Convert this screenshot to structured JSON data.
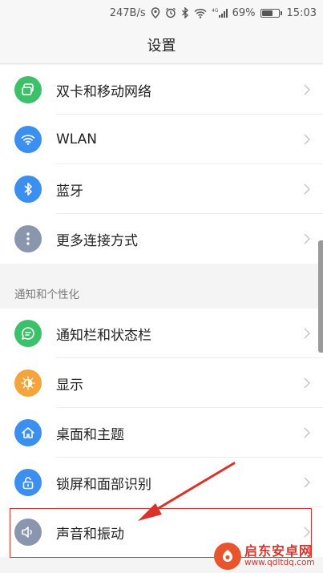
{
  "status_bar": {
    "net_speed": "247B/s",
    "signal": "4G",
    "battery": "69%",
    "battery_level": 0.69,
    "time": "15:03"
  },
  "header": {
    "title": "设置"
  },
  "connectivity": [
    {
      "label": "双卡和移动网络",
      "icon": "dual-sim-icon",
      "color": "#3cc06a"
    },
    {
      "label": "WLAN",
      "icon": "wifi-icon",
      "color": "#3b8ff0"
    },
    {
      "label": "蓝牙",
      "icon": "bluetooth-icon",
      "color": "#3b8ff0"
    },
    {
      "label": "更多连接方式",
      "icon": "more-dots-icon",
      "color": "#8a96ad"
    }
  ],
  "personalization": {
    "header": "通知和个性化",
    "items": [
      {
        "label": "通知栏和状态栏",
        "icon": "notification-icon",
        "color": "#3cc06a"
      },
      {
        "label": "显示",
        "icon": "display-icon",
        "color": "#f3a53c"
      },
      {
        "label": "桌面和主题",
        "icon": "home-icon",
        "color": "#3b8ff0"
      },
      {
        "label": "锁屏和面部识别",
        "icon": "lock-icon",
        "color": "#3b8ff0"
      },
      {
        "label": "声音和振动",
        "icon": "speaker-icon",
        "color": "#8a96ad"
      }
    ]
  },
  "colors": {
    "highlight": "#d9342b",
    "watermark": "#d9342b"
  },
  "watermark": {
    "title": "启东安卓网",
    "url": "www.qdltdq.com"
  }
}
